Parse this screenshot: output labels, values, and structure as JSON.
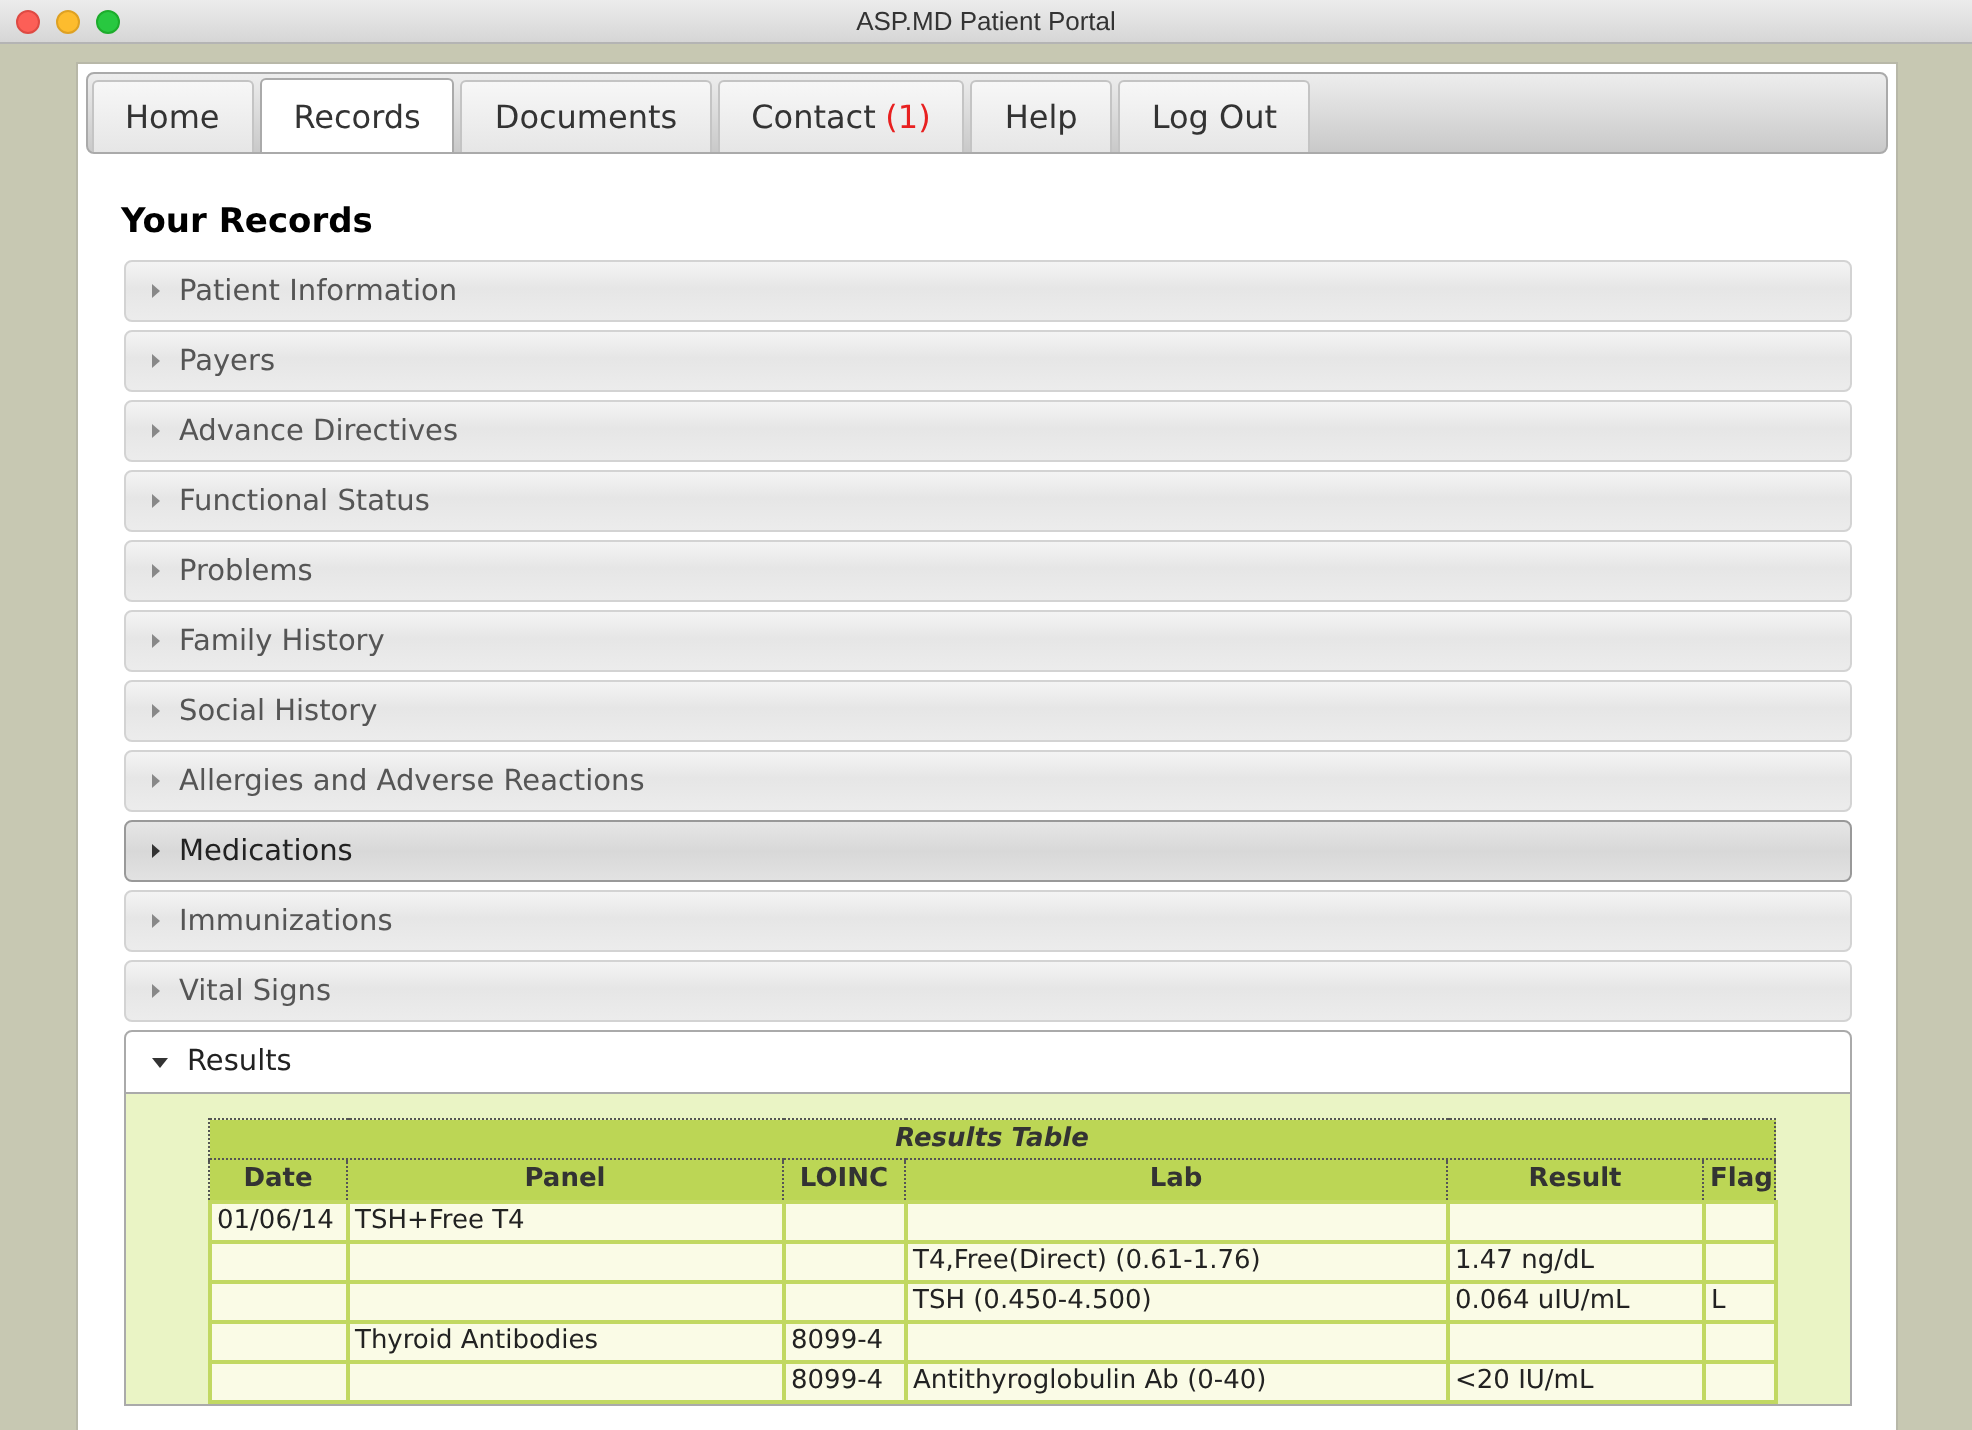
{
  "window": {
    "title": "ASP.MD Patient Portal"
  },
  "tabs": [
    {
      "label": "Home",
      "selected": false
    },
    {
      "label": "Records",
      "selected": true
    },
    {
      "label": "Documents",
      "selected": false
    },
    {
      "label": "Contact",
      "badge": "(1)",
      "selected": false
    },
    {
      "label": "Help",
      "selected": false
    },
    {
      "label": "Log Out",
      "selected": false
    }
  ],
  "heading": "Your Records",
  "sections": [
    {
      "title": "Patient Information",
      "expanded": false,
      "selected": false
    },
    {
      "title": "Payers",
      "expanded": false,
      "selected": false
    },
    {
      "title": "Advance Directives",
      "expanded": false,
      "selected": false
    },
    {
      "title": "Functional Status",
      "expanded": false,
      "selected": false
    },
    {
      "title": "Problems",
      "expanded": false,
      "selected": false
    },
    {
      "title": "Family History",
      "expanded": false,
      "selected": false
    },
    {
      "title": "Social History",
      "expanded": false,
      "selected": false
    },
    {
      "title": "Allergies and Adverse Reactions",
      "expanded": false,
      "selected": false
    },
    {
      "title": "Medications",
      "expanded": false,
      "selected": true
    },
    {
      "title": "Immunizations",
      "expanded": false,
      "selected": false
    },
    {
      "title": "Vital Signs",
      "expanded": false,
      "selected": false
    },
    {
      "title": "Results",
      "expanded": true,
      "selected": false,
      "table": {
        "title": "Results Table",
        "columns": [
          "Date",
          "Panel",
          "LOINC",
          "Lab",
          "Result",
          "Flag"
        ],
        "rows": [
          {
            "date": "01/06/14",
            "panel": "TSH+Free T4"
          },
          {
            "lab": "T4,Free(Direct) (0.61-1.76)",
            "result": "1.47 ng/dL"
          },
          {
            "lab": "TSH (0.450-4.500)",
            "result": "0.064 uIU/mL",
            "flag": "L"
          },
          {
            "panel": "Thyroid Antibodies",
            "loinc": "8099-4"
          },
          {
            "loinc": "8099-4",
            "lab": "Antithyroglobulin Ab (0-40)",
            "result": "<20 IU/mL"
          }
        ]
      }
    }
  ]
}
